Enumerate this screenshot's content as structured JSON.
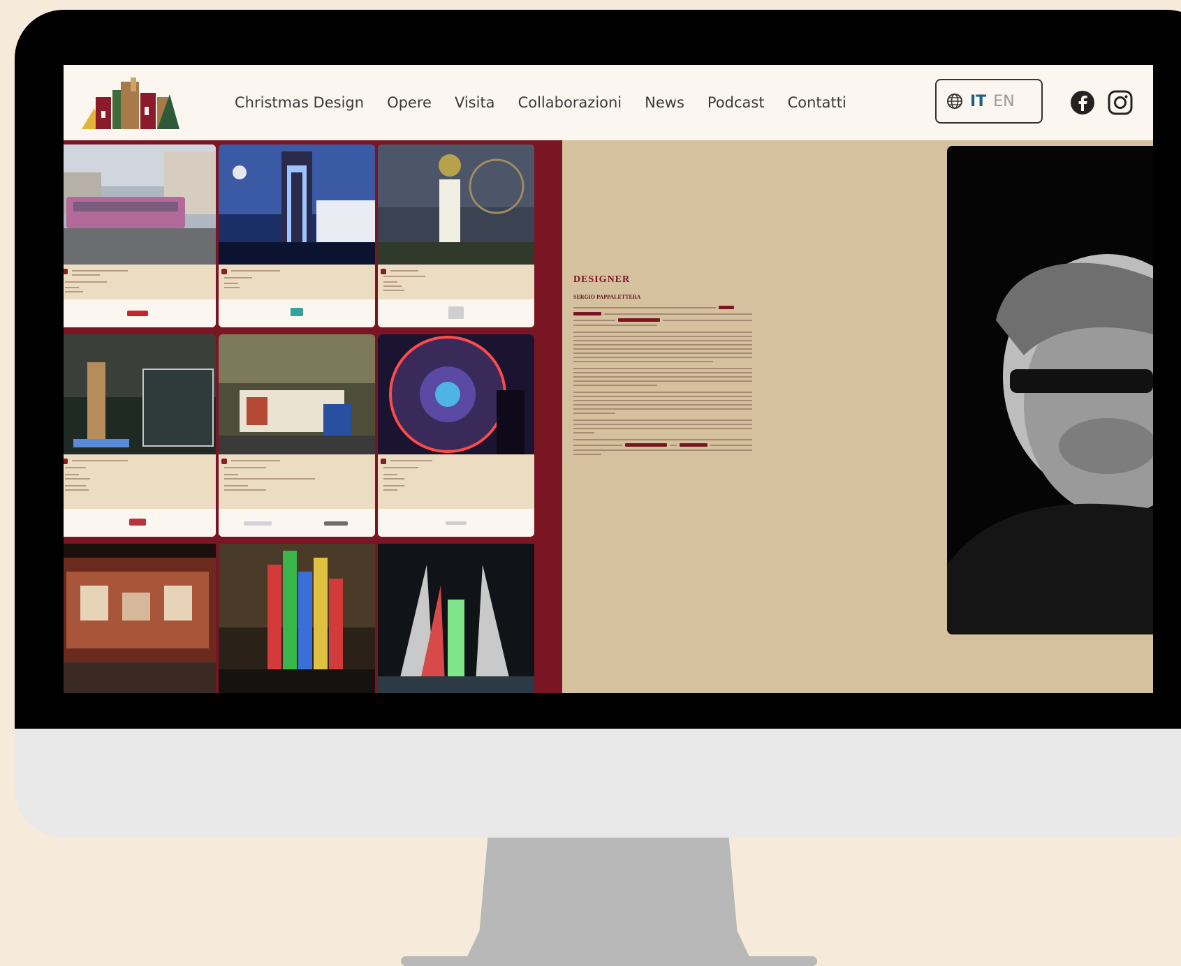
{
  "nav": {
    "items": [
      {
        "label": "Christmas Design"
      },
      {
        "label": "Opere"
      },
      {
        "label": "Visita"
      },
      {
        "label": "Collaborazioni"
      },
      {
        "label": "News"
      },
      {
        "label": "Podcast"
      },
      {
        "label": "Contatti"
      }
    ]
  },
  "lang": {
    "it": "IT",
    "en": "EN",
    "active": "IT"
  },
  "designer": {
    "heading": "DESIGNER",
    "name": "SERGIO PAPPALETTERA"
  },
  "icons": {
    "globe": "globe-icon",
    "facebook": "facebook-icon",
    "instagram": "instagram-icon"
  },
  "colors": {
    "accent": "#7a1524",
    "active_lang": "#1d5f86",
    "panel": "#d6c19e",
    "header": "#fbf6ef"
  }
}
